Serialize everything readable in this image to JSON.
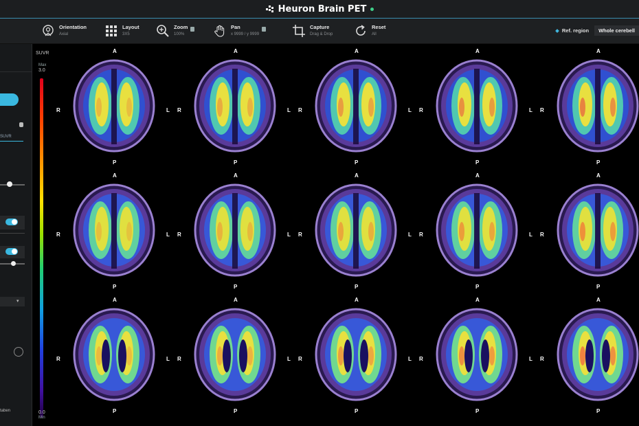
{
  "app": {
    "title": "Heuron Brain PET"
  },
  "toolbar": {
    "tools": [
      {
        "name": "Orientation",
        "sub": "Axial",
        "icon": "orientation-head-icon"
      },
      {
        "name": "Layout",
        "sub": "3X5",
        "icon": "layout-grid-icon"
      },
      {
        "name": "Zoom",
        "sub": "100%",
        "icon": "zoom-icon"
      },
      {
        "name": "Pan",
        "sub": "x 9999 / y 9999",
        "icon": "pan-hand-icon"
      },
      {
        "name": "Capture",
        "sub": "Drag & Drop",
        "icon": "crop-capture-icon"
      },
      {
        "name": "Reset",
        "sub": "All",
        "icon": "reset-icon"
      }
    ],
    "ref_region_label": "Ref. region",
    "ref_region_value": "Whole cerebell"
  },
  "sidebar": {
    "tab_label": "SUVR",
    "bottom_label": "taben"
  },
  "scale": {
    "title": "SUVR",
    "max_label": "Max",
    "max_value": "3.0",
    "min_value": "0.0",
    "min_label": "Min"
  },
  "orientation_labels": {
    "anterior": "A",
    "posterior": "P",
    "right": "R",
    "left": "L"
  },
  "layout": {
    "rows": 3,
    "cols": 5
  },
  "colors": {
    "accent": "#3ab8e0",
    "background": "#000000",
    "panel": "#1e2022",
    "status_dot": "#3fd08a"
  }
}
